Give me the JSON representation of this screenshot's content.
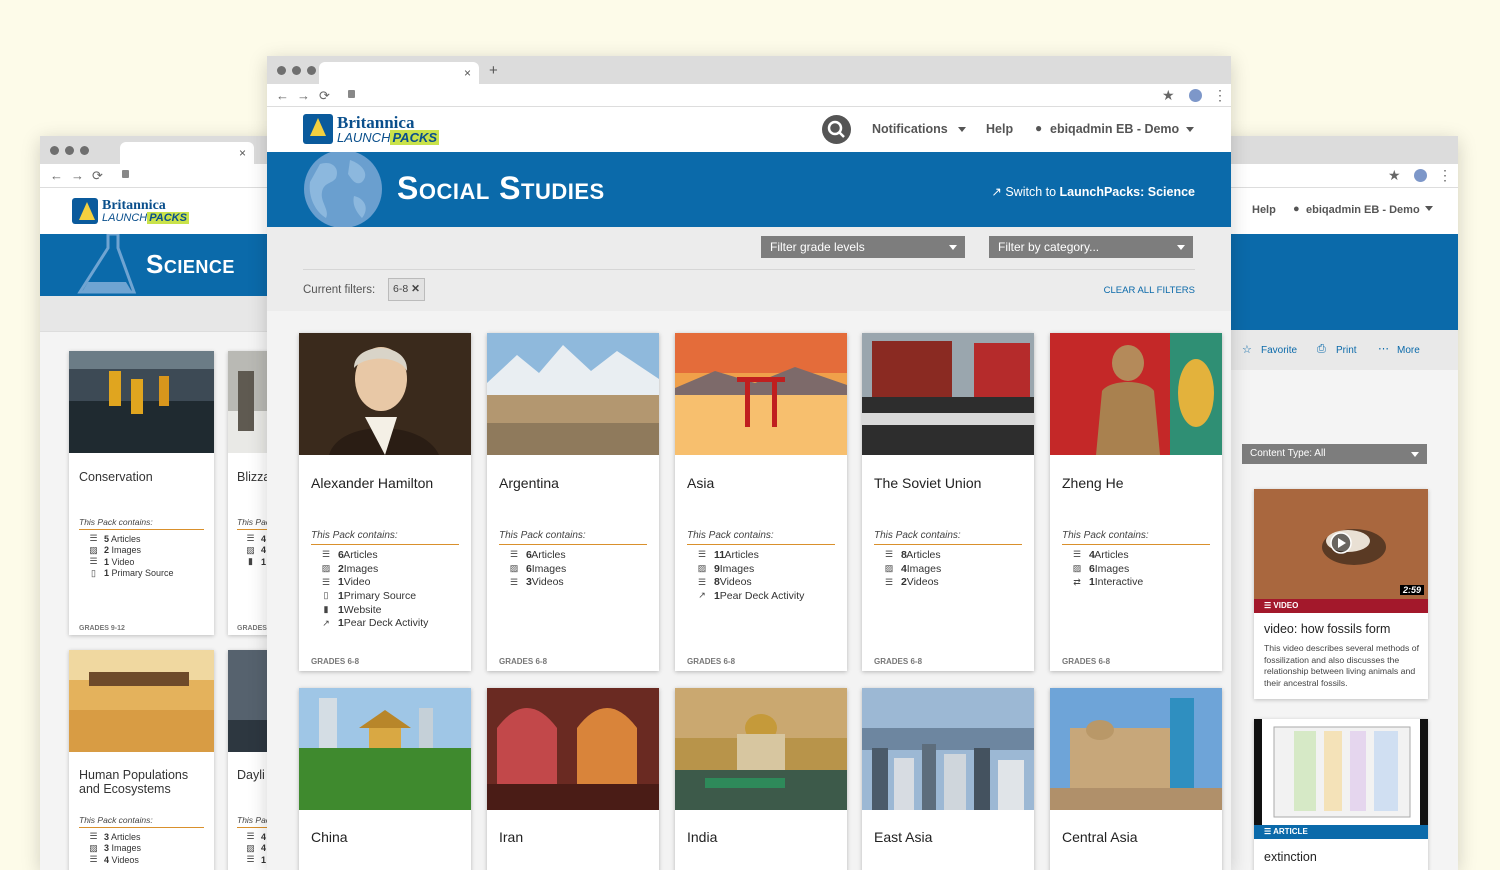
{
  "left_window": {
    "tab_close": "×",
    "nav": {
      "back": "←",
      "forward": "→",
      "reload": "⟳"
    },
    "logo": {
      "brand": "Britannica",
      "product_prefix": "LAUNCH",
      "product_suffix": "PACKS"
    },
    "banner_title": "Science",
    "cards": [
      {
        "title": "Conservation",
        "pack_label": "This Pack contains:",
        "items": [
          {
            "icon": "list-icon",
            "glyph": "☰",
            "count": "5",
            "label": "Articles"
          },
          {
            "icon": "image-icon",
            "glyph": "▨",
            "count": "2",
            "label": "Images"
          },
          {
            "icon": "video-icon",
            "glyph": "☰",
            "count": "1",
            "label": "Video"
          },
          {
            "icon": "document-icon",
            "glyph": "▯",
            "count": "1",
            "label": "Primary Source"
          }
        ],
        "grade": "GRADES 9-12"
      },
      {
        "title": "Blizza",
        "pack_label": "This Pac",
        "items": [
          {
            "icon": "list-icon",
            "glyph": "☰",
            "count": "4",
            "label": ""
          },
          {
            "icon": "image-icon",
            "glyph": "▨",
            "count": "4",
            "label": ""
          },
          {
            "icon": "bookmark-icon",
            "glyph": "▮",
            "count": "1",
            "label": ""
          }
        ],
        "grade": "GRADES"
      },
      {
        "title": "Human Populations and Ecosystems",
        "pack_label": "This Pack contains:",
        "items": [
          {
            "icon": "list-icon",
            "glyph": "☰",
            "count": "3",
            "label": "Articles"
          },
          {
            "icon": "image-icon",
            "glyph": "▨",
            "count": "3",
            "label": "Images"
          },
          {
            "icon": "video-icon",
            "glyph": "☰",
            "count": "4",
            "label": "Videos"
          }
        ]
      },
      {
        "title": "Dayli",
        "pack_label": "This Pac",
        "items": [
          {
            "icon": "list-icon",
            "glyph": "☰",
            "count": "4",
            "label": ""
          },
          {
            "icon": "image-icon",
            "glyph": "▨",
            "count": "4",
            "label": ""
          },
          {
            "icon": "video-icon",
            "glyph": "☰",
            "count": "1",
            "label": ""
          }
        ]
      }
    ]
  },
  "right_window": {
    "help": "Help",
    "user": "ebiqadmin EB - Demo",
    "actions": {
      "favorite": "Favorite",
      "print": "Print",
      "more": "More"
    },
    "content_type": "Content Type: All",
    "video_card": {
      "badge": "VIDEO",
      "duration": "2:59",
      "title": "video: how fossils form",
      "description": "This video describes several methods of fossilization and also discusses the relationship between living animals and their ancestral fossils."
    },
    "article_card": {
      "badge": "ARTICLE",
      "title": "extinction"
    }
  },
  "main_window": {
    "tab_close": "×",
    "new_tab": "+",
    "nav": {
      "back": "←",
      "forward": "→",
      "reload": "⟳"
    },
    "logo": {
      "brand": "Britannica",
      "product_prefix": "LAUNCH",
      "product_suffix": "PACKS"
    },
    "header": {
      "notifications": "Notifications",
      "help": "Help",
      "user": "ebiqadmin EB - Demo"
    },
    "banner": {
      "title": "Social Studies",
      "switch_prefix": "Switch to ",
      "switch_target": "LaunchPacks: Science"
    },
    "filters": {
      "grade_placeholder": "Filter grade levels",
      "category_placeholder": "Filter by category...",
      "current_label": "Current filters:",
      "active_chip": "6-8",
      "clear_all": "CLEAR ALL FILTERS"
    },
    "packs": [
      {
        "title": "Alexander Hamilton",
        "pack_label": "This Pack contains:",
        "grade": "GRADES 6-8",
        "items": [
          {
            "icon": "list-icon",
            "glyph": "☰",
            "count": "6",
            "label": "Articles"
          },
          {
            "icon": "image-icon",
            "glyph": "▨",
            "count": "2",
            "label": "Images"
          },
          {
            "icon": "video-icon",
            "glyph": "☰",
            "count": "1",
            "label": "Video"
          },
          {
            "icon": "document-icon",
            "glyph": "▯",
            "count": "1",
            "label": "Primary Source"
          },
          {
            "icon": "bookmark-icon",
            "glyph": "▮",
            "count": "1",
            "label": "Website"
          },
          {
            "icon": "external-link-icon",
            "glyph": "↗",
            "count": "1",
            "label": "Pear Deck Activity"
          }
        ]
      },
      {
        "title": "Argentina",
        "pack_label": "This Pack contains:",
        "grade": "GRADES 6-8",
        "items": [
          {
            "icon": "list-icon",
            "glyph": "☰",
            "count": "6",
            "label": "Articles"
          },
          {
            "icon": "image-icon",
            "glyph": "▨",
            "count": "6",
            "label": "Images"
          },
          {
            "icon": "video-icon",
            "glyph": "☰",
            "count": "3",
            "label": "Videos"
          }
        ]
      },
      {
        "title": "Asia",
        "pack_label": "This Pack contains:",
        "grade": "GRADES 6-8",
        "items": [
          {
            "icon": "list-icon",
            "glyph": "☰",
            "count": "11",
            "label": "Articles"
          },
          {
            "icon": "image-icon",
            "glyph": "▨",
            "count": "9",
            "label": "Images"
          },
          {
            "icon": "video-icon",
            "glyph": "☰",
            "count": "8",
            "label": "Videos"
          },
          {
            "icon": "external-link-icon",
            "glyph": "↗",
            "count": "1",
            "label": "Pear Deck Activity"
          }
        ]
      },
      {
        "title": "The Soviet Union",
        "pack_label": "This Pack contains:",
        "grade": "GRADES 6-8",
        "items": [
          {
            "icon": "list-icon",
            "glyph": "☰",
            "count": "8",
            "label": "Articles"
          },
          {
            "icon": "image-icon",
            "glyph": "▨",
            "count": "4",
            "label": "Images"
          },
          {
            "icon": "video-icon",
            "glyph": "☰",
            "count": "2",
            "label": "Videos"
          }
        ]
      },
      {
        "title": "Zheng He",
        "pack_label": "This Pack contains:",
        "grade": "GRADES 6-8",
        "items": [
          {
            "icon": "list-icon",
            "glyph": "☰",
            "count": "4",
            "label": "Articles"
          },
          {
            "icon": "image-icon",
            "glyph": "▨",
            "count": "6",
            "label": "Images"
          },
          {
            "icon": "interactive-icon",
            "glyph": "⇄",
            "count": "1",
            "label": "Interactive"
          }
        ]
      },
      {
        "title": "China"
      },
      {
        "title": "Iran"
      },
      {
        "title": "India"
      },
      {
        "title": "East Asia"
      },
      {
        "title": "Central Asia"
      }
    ]
  }
}
